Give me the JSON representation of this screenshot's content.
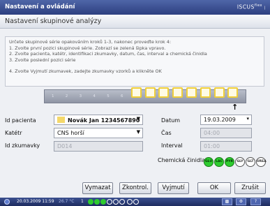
{
  "window": {
    "title": "Nastavení a ovládání",
    "brand": "ISCUS",
    "brand_sup": "flex",
    "brand_suffix": "| flex"
  },
  "header": {
    "title": "Nastavení skupinové analýzy"
  },
  "instructions": {
    "lines": [
      "Určete skupinové série opakováním kroků 1-3, nakonec proveďte krok 4:",
      "1. Zvolte první pozici skupinové série. Zobrazí se zelená šipka vpravo.",
      "2. Zvolte pacienta, katétr, identifikaci zkumavky, datum, čas, interval a chemická činidla",
      "3. Zvolte poslední pozici série",
      "",
      "4. Zvolte Vyjmutí zkumavek, zadejte zkumavky vzorků a klikněte OK"
    ]
  },
  "positions": [
    "1",
    "2",
    "3",
    "4",
    "5",
    "6",
    "7",
    "8",
    "9",
    "10",
    "11",
    "12",
    "13",
    "14"
  ],
  "form": {
    "patient_label": "Id pacienta",
    "patient_value": "Novák Jan 1234567890",
    "catheter_label": "Katétr",
    "catheter_value": "CNS horší",
    "tube_label": "Id zkumavky",
    "tube_value": "D014",
    "date_label": "Datum",
    "date_value": "19.03.2009",
    "time_label": "Čas",
    "time_value": "04:00",
    "interval_label": "Interval",
    "interval_value": "01:00",
    "reagents_label": "Chemická činidla"
  },
  "reagents": [
    {
      "code": "GLU",
      "selected": true
    },
    {
      "code": "LAC",
      "selected": true
    },
    {
      "code": "PYR",
      "selected": true
    },
    {
      "code": "GLY",
      "selected": false
    },
    {
      "code": "GLT",
      "selected": false
    },
    {
      "code": "UREA",
      "selected": false
    }
  ],
  "buttons": {
    "clear": "Vymazat",
    "control": "Zkontrol.",
    "remove": "Vyjmutí",
    "ok": "OK",
    "cancel": "Zrušit"
  },
  "taskbar": {
    "datetime": "20.03.2009 11:59",
    "temperature": "26.7 °C",
    "count": "1"
  },
  "colors": {
    "accent": "#2d3f80",
    "slot_border": "#f0cf3a",
    "selected_reagent": "#2ecc2e"
  }
}
